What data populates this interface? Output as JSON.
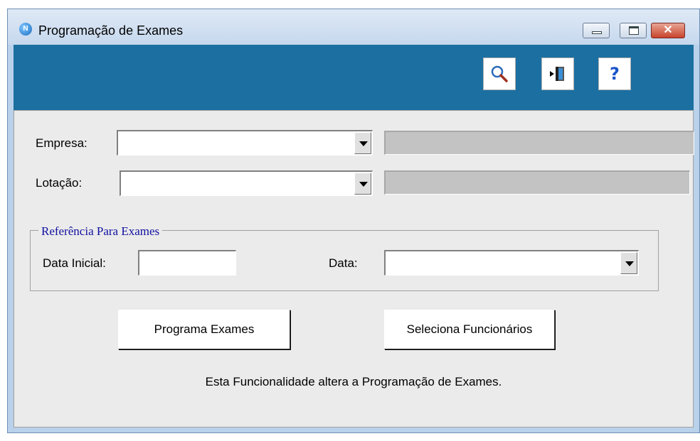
{
  "window": {
    "title": "Programação de Exames",
    "app_icon_letter": "N",
    "close_glyph": "✕"
  },
  "toolbar": {
    "search_icon": "search-icon",
    "exit_icon": "exit-door-icon",
    "help_label": "?"
  },
  "form": {
    "empresa_label": "Empresa:",
    "empresa_value": "",
    "lotacao_label": "Lotação:",
    "lotacao_value": "",
    "group_title": "Referência Para Exames",
    "data_inicial_label": "Data Inicial:",
    "data_inicial_value": "",
    "data_label": "Data:",
    "data_value": ""
  },
  "buttons": {
    "programa": "Programa Exames",
    "seleciona": "Seleciona Funcionários"
  },
  "info_text": "Esta Funcionalidade altera a Programação de Exames.",
  "colors": {
    "toolbar": "#1c6fa1",
    "body": "#ebebeb",
    "group_title": "#1010a0"
  }
}
